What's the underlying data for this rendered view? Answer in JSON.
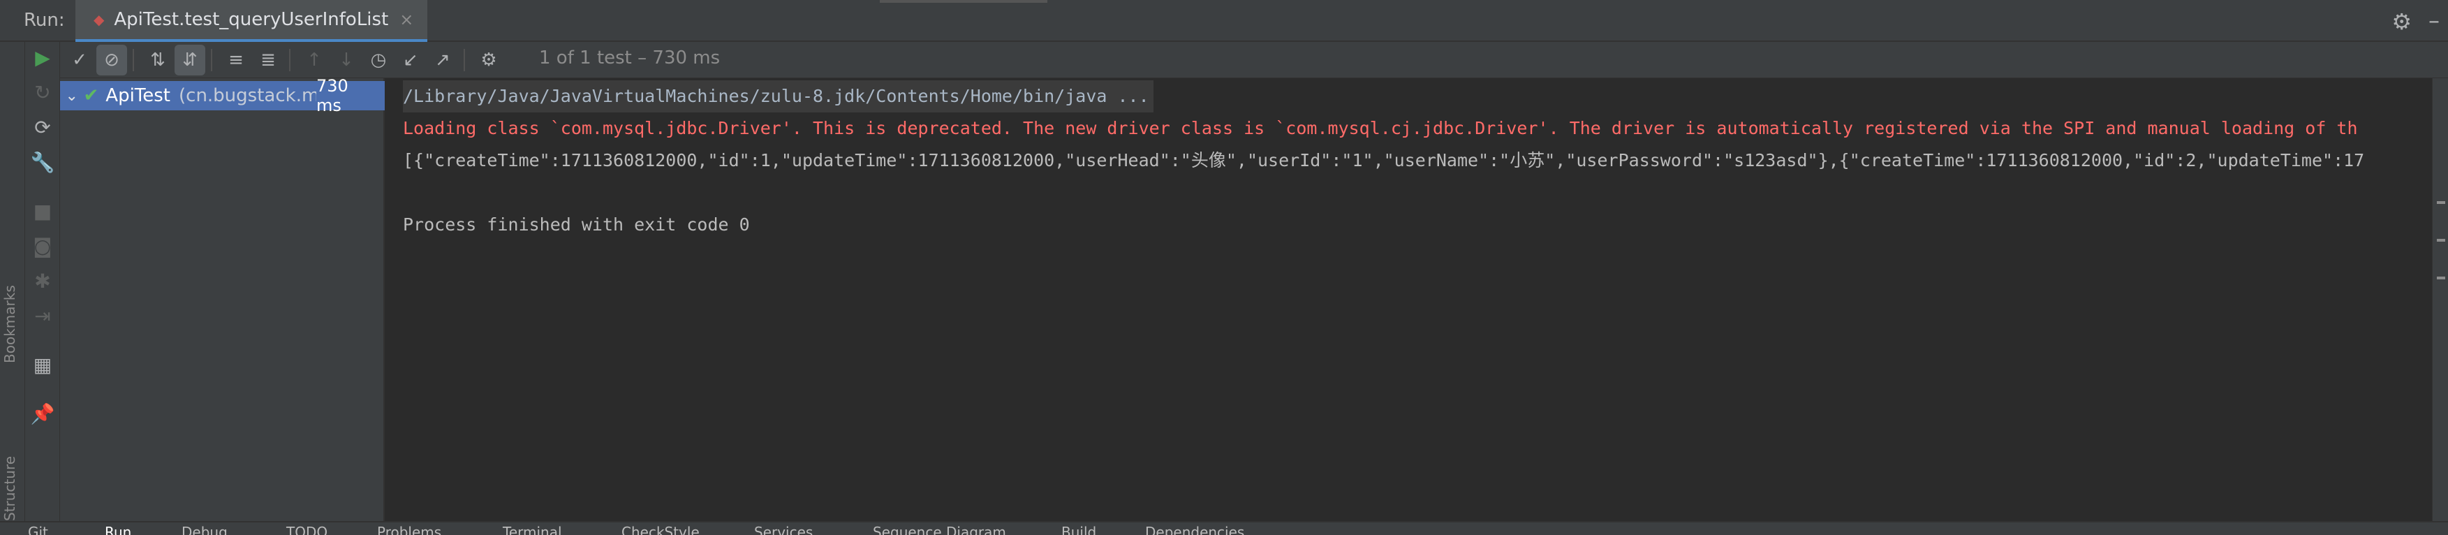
{
  "run_panel": {
    "label": "Run:",
    "tab_title": "ApiTest.test_queryUserInfoList",
    "close_glyph": "×"
  },
  "left_strip": {
    "bookmarks_label": "Bookmarks",
    "structure_label": "Structure"
  },
  "toolbar": {
    "test_status": "1 of 1 test – 730 ms"
  },
  "test_tree": {
    "root": {
      "name": "ApiTest",
      "package": "(cn.bugstack.m",
      "duration": "730 ms",
      "status_icon": "check-icon"
    }
  },
  "console": {
    "lines": [
      "/Library/Java/JavaVirtualMachines/zulu-8.jdk/Contents/Home/bin/java ...",
      "Loading class `com.mysql.jdbc.Driver'. This is deprecated. The new driver class is `com.mysql.cj.jdbc.Driver'. The driver is automatically registered via the SPI and manual loading of th",
      "[{\"createTime\":1711360812000,\"id\":1,\"updateTime\":1711360812000,\"userHead\":\"头像\",\"userId\":\"1\",\"userName\":\"小苏\",\"userPassword\":\"s123asd\"},{\"createTime\":1711360812000,\"id\":2,\"updateTime\":17",
      "Process finished with exit code 0"
    ]
  },
  "bottom_bar": {
    "items": [
      "Git",
      "Run",
      "Debug",
      "TODO",
      "Problems",
      "Terminal",
      "CheckStyle",
      "Services",
      "Sequence Diagram",
      "Build",
      "Dependencies"
    ]
  },
  "colors": {
    "background": "#2b2b2b",
    "panel": "#3c3f41",
    "selection": "#4b6eaf",
    "error_text": "#ff6b68",
    "success_green": "#499c54"
  }
}
